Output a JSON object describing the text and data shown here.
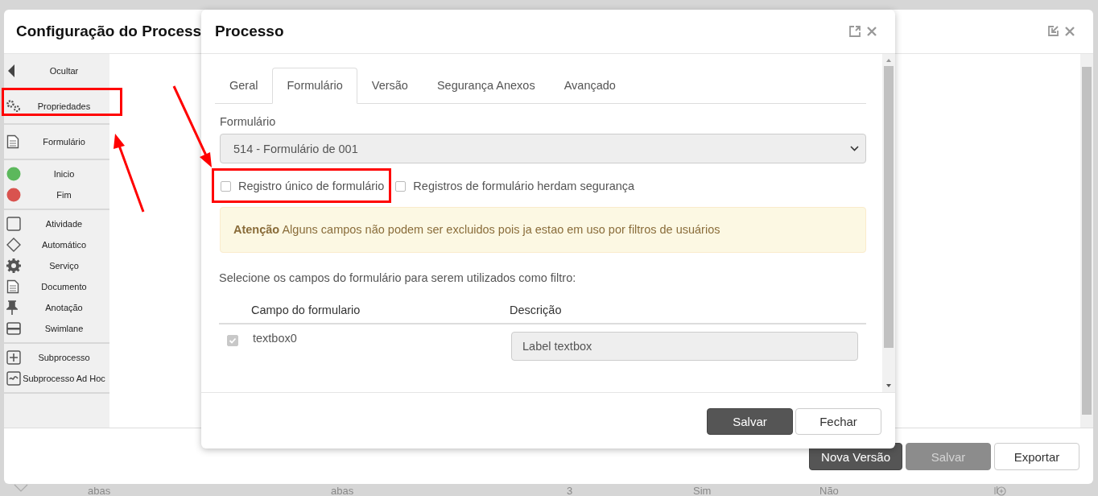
{
  "window": {
    "title": "Configuração do Process"
  },
  "palette": {
    "groups": [
      {
        "items": [
          {
            "label": "Ocultar"
          }
        ]
      },
      {
        "items": [
          {
            "label": "Propriedades"
          }
        ]
      },
      {
        "items": [
          {
            "label": "Formulário"
          }
        ]
      },
      {
        "items": [
          {
            "label": "Inicio",
            "color": "#5cb85c"
          },
          {
            "label": "Fim",
            "color": "#d9534f"
          }
        ]
      },
      {
        "items": [
          {
            "label": "Atividade"
          },
          {
            "label": "Automático"
          },
          {
            "label": "Serviço"
          },
          {
            "label": "Documento"
          },
          {
            "label": "Anotação"
          },
          {
            "label": "Swimlane"
          }
        ]
      },
      {
        "items": [
          {
            "label": "Subprocesso"
          },
          {
            "label": "Subprocesso Ad Hoc"
          }
        ]
      }
    ]
  },
  "footer_buttons": [
    {
      "label": "Nova Versão",
      "kind": "primary",
      "disabled": false
    },
    {
      "label": "Salvar",
      "kind": "primary",
      "disabled": true
    },
    {
      "label": "Exportar",
      "kind": "default",
      "disabled": false
    }
  ],
  "background_row": [
    "abas",
    "abas",
    "3",
    "Sim",
    "Não"
  ],
  "dialog": {
    "title": "Processo",
    "tabs": [
      {
        "label": "Geral",
        "selected": false
      },
      {
        "label": "Formulário",
        "selected": true
      },
      {
        "label": "Versão",
        "selected": false
      },
      {
        "label": "Segurança Anexos",
        "selected": false
      },
      {
        "label": "Avançado",
        "selected": false
      }
    ],
    "form_label": "Formulário",
    "form_value": "514 - Formulário de 001",
    "options": [
      {
        "label": "Registro único de formulário",
        "checked": false
      },
      {
        "label": "Registros de formulário herdam segurança",
        "checked": false
      }
    ],
    "alert": "**Atenção** Alguns campos não podem ser excluidos pois ja estao em uso por filtros de usuários",
    "instruction": "Selecione os campos do formulário para serem utilizados como filtro:",
    "table": {
      "columns": [
        "Campo do formulario",
        "Descrição"
      ],
      "rows": [
        {
          "field": "textbox0",
          "checked": true,
          "description": "Label textbox"
        }
      ]
    },
    "buttons": [
      {
        "label": "Salvar",
        "kind": "primary"
      },
      {
        "label": "Fechar",
        "kind": "default"
      }
    ]
  }
}
